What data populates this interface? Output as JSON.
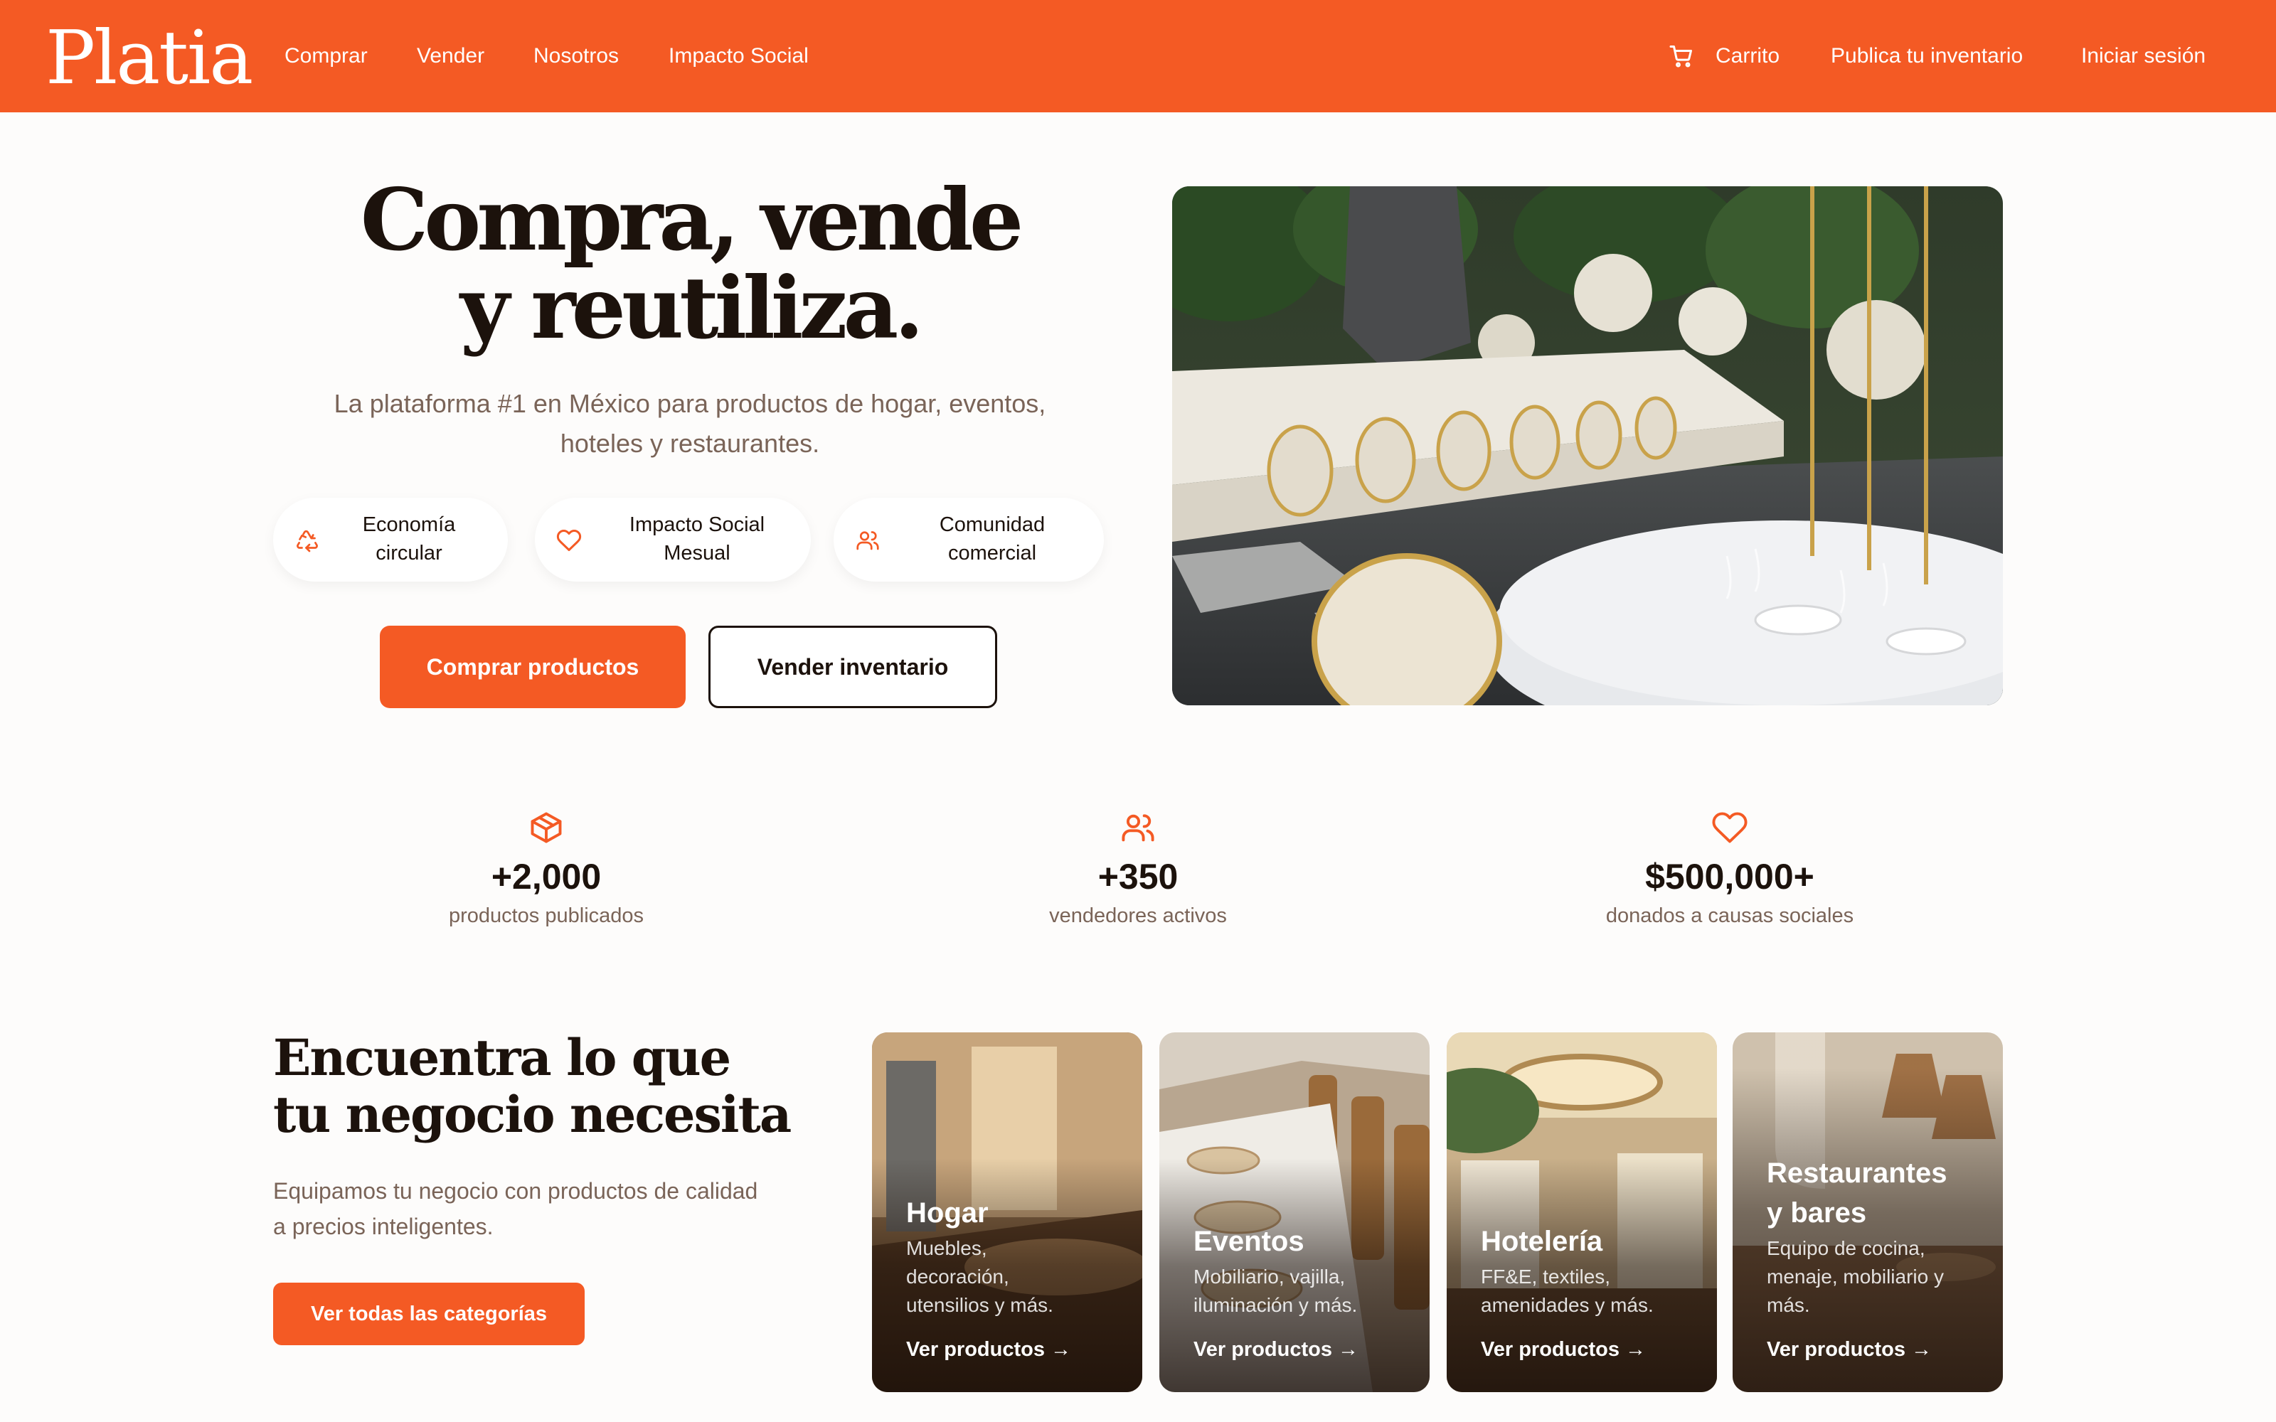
{
  "nav": {
    "logo": "Platia",
    "links": [
      "Comprar",
      "Vender",
      "Nosotros",
      "Impacto Social"
    ],
    "cart_label": "Carrito",
    "publish_label": "Publica tu inventario",
    "login_label": "Iniciar sesión"
  },
  "hero": {
    "title_line1": "Compra, vende",
    "title_line2": "y reutiliza.",
    "subtitle_line1": "La plataforma #1 en México para productos de hogar, eventos,",
    "subtitle_line2": "hoteles y restaurantes.",
    "features": [
      {
        "icon": "recycle-icon",
        "line1": "Economía",
        "line2": "circular"
      },
      {
        "icon": "heart-icon",
        "line1": "Impacto Social",
        "line2": "Mesual"
      },
      {
        "icon": "users-icon",
        "line1": "Comunidad",
        "line2": "comercial"
      }
    ],
    "primary_button": "Comprar productos",
    "secondary_button": "Vender inventario",
    "image": "event-banquet-tables-photo"
  },
  "stats": [
    {
      "icon": "box-icon",
      "value": "+2,000",
      "label": "productos publicados"
    },
    {
      "icon": "users-icon",
      "value": "+350",
      "label": "vendedores activos"
    },
    {
      "icon": "heart-icon",
      "value": "$500,000+",
      "label": "donados a causas sociales"
    }
  ],
  "categories": {
    "title_line1": "Encuentra lo que",
    "title_line2": "tu negocio necesita",
    "subtitle_line1": "Equipamos tu negocio con productos de calidad",
    "subtitle_line2": "a precios inteligentes.",
    "button": "Ver todas las categorías",
    "cards": [
      {
        "title_line1": "Hogar",
        "title_line2": "",
        "desc": [
          "Muebles,",
          "decoración,",
          "utensilios y más."
        ],
        "link": "Ver productos →"
      },
      {
        "title_line1": "Eventos",
        "title_line2": "",
        "desc": [
          "Mobiliario, vajilla,",
          "iluminación y más."
        ],
        "link": "Ver productos →"
      },
      {
        "title_line1": "Hotelería",
        "title_line2": "",
        "desc": [
          "FF&E, textiles,",
          "amenidades y más."
        ],
        "link": "Ver productos →"
      },
      {
        "title_line1": "Restaurantes",
        "title_line2": "y bares",
        "desc": [
          "Equipo de cocina,",
          "menaje, mobiliario y",
          "más."
        ],
        "link": "Ver productos →"
      }
    ]
  },
  "colors": {
    "brand_orange": "#f45a24",
    "heading_dark": "#1c120c",
    "muted_text": "#7a6458",
    "background": "#fdfcfb"
  }
}
